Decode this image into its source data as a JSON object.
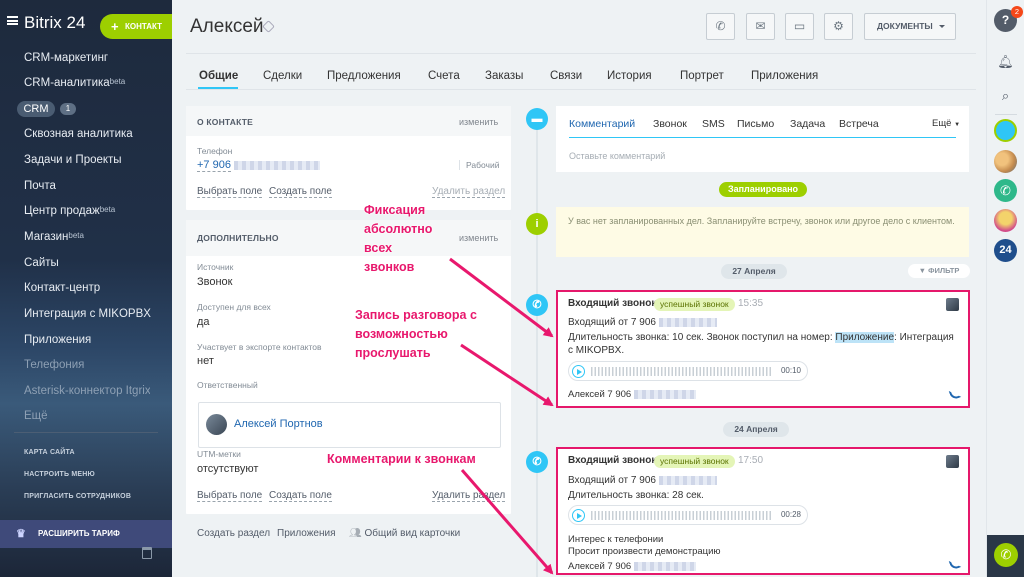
{
  "sidebar": {
    "logo": "Bitrix 24",
    "contact_button": "КОНТАКТ",
    "items": [
      {
        "label": "CRM-маркетинг",
        "beta": ""
      },
      {
        "label": "CRM-аналитика",
        "beta": "beta"
      },
      {
        "label": "Сквозная аналитика",
        "beta": ""
      },
      {
        "label": "Задачи и Проекты",
        "beta": ""
      },
      {
        "label": "Почта",
        "beta": ""
      },
      {
        "label": "Центр продаж",
        "beta": "beta"
      },
      {
        "label": "Магазин",
        "beta": "beta"
      },
      {
        "label": "Сайты",
        "beta": ""
      },
      {
        "label": "Контакт-центр",
        "beta": ""
      },
      {
        "label": "Интеграция с MIKOPBX",
        "beta": ""
      },
      {
        "label": "Приложения",
        "beta": ""
      },
      {
        "label": "Телефония",
        "beta": ""
      },
      {
        "label": "Asterisk-коннектор Itgrix",
        "beta": ""
      },
      {
        "label": "Ещё",
        "beta": ""
      }
    ],
    "crm_label": "CRM",
    "crm_count": "1",
    "sitemap": "КАРТА САЙТА",
    "settings": "НАСТРОИТЬ МЕНЮ",
    "invite": "ПРИГЛАСИТЬ СОТРУДНИКОВ",
    "upgrade": "РАСШИРИТЬ ТАРИФ"
  },
  "header": {
    "title": "Алексей",
    "documents": "ДОКУМЕНТЫ"
  },
  "tabs": [
    "Общие",
    "Сделки",
    "Предложения",
    "Счета",
    "Заказы",
    "Связи",
    "История",
    "Портрет",
    "Приложения"
  ],
  "about": {
    "title": "О КОНТАКТЕ",
    "edit": "изменить",
    "phone_label": "Телефон",
    "phone_value": "+7 906",
    "phone_type": "Рабочий",
    "select_field": "Выбрать поле",
    "create_field": "Создать поле",
    "delete_section": "Удалить раздел"
  },
  "extra": {
    "title": "ДОПОЛНИТЕЛЬНО",
    "edit": "изменить",
    "source_label": "Источник",
    "source_value": "Звонок",
    "public_label": "Доступен для всех",
    "public_value": "да",
    "export_label": "Участвует в экспорте контактов",
    "export_value": "нет",
    "resp_label": "Ответственный",
    "resp_value": "Алексей Портнов",
    "utm_label": "UTM-метки",
    "utm_value": "отсутствуют",
    "select_field": "Выбрать поле",
    "create_field": "Создать поле",
    "delete_section": "Удалить раздел"
  },
  "footer_links": {
    "create_section": "Создать раздел",
    "apps": "Приложения",
    "common_view": "Общий вид карточки"
  },
  "composer": {
    "tabs": [
      "Комментарий",
      "Звонок",
      "SMS",
      "Письмо",
      "Задача",
      "Встреча"
    ],
    "more": "Ещё",
    "placeholder": "Оставьте комментарий"
  },
  "timeline": {
    "planned": "Запланировано",
    "empty_text": "У вас нет запланированных дел. Запланируйте встречу, звонок или другое дело с клиентом.",
    "filter": "ФИЛЬТР",
    "date1": "27 Апреля",
    "date2": "24 Апреля",
    "events": [
      {
        "title": "Входящий звонок",
        "badge": "успешный звонок",
        "time": "15:35",
        "from": "Входящий от 7 906",
        "text_a": "Длительность звонка: 10 сек. Звонок поступил на номер: ",
        "text_hl": "Приложение",
        "text_b": ": Интеграция",
        "text2": "с MIKOPBX.",
        "duration": "00:10",
        "contact": "Алексей 7 906"
      },
      {
        "title": "Входящий звонок",
        "badge": "успешный звонок",
        "time": "17:50",
        "from": "Входящий от 7 906",
        "text_a": "Длительность звонка: 28 сек.",
        "duration": "00:28",
        "comment1": "Интерес к телефонии",
        "comment2": "Просит произвести демонстрацию",
        "contact": "Алексей 7 906"
      }
    ]
  },
  "annotations": {
    "a1": [
      "Фиксация",
      "абсолютно",
      "всех",
      "звонков"
    ],
    "a2": [
      "Запись разговора с",
      "возможностью",
      "прослушать"
    ],
    "a3": "Комментарии к звонкам"
  },
  "rightbar": {
    "notify_count": "2"
  },
  "colors": {
    "accent_green": "#9dcf00",
    "accent_blue": "#2fc6f6",
    "highlight_pink": "#e5186b",
    "link_blue": "#2067b0"
  }
}
